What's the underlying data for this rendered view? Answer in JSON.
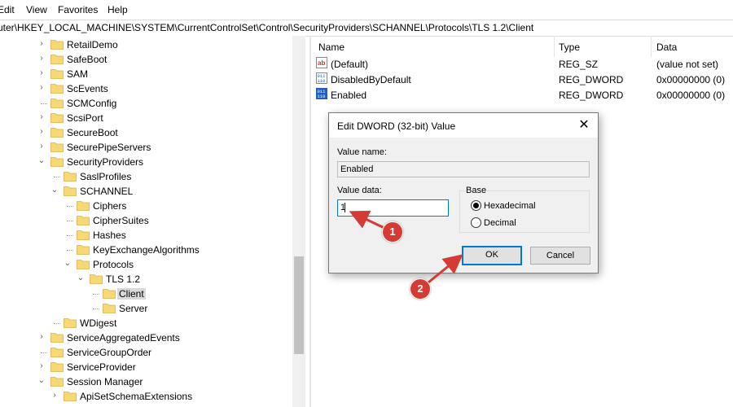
{
  "menu": [
    "Edit",
    "View",
    "Favorites",
    "Help"
  ],
  "address": "uter\\HKEY_LOCAL_MACHINE\\SYSTEM\\CurrentControlSet\\Control\\SecurityProviders\\SCHANNEL\\Protocols\\TLS 1.2\\Client",
  "tree": [
    {
      "label": "RetailDemo",
      "level": 0,
      "expander": "collapsed"
    },
    {
      "label": "SafeBoot",
      "level": 0,
      "expander": "collapsed"
    },
    {
      "label": "SAM",
      "level": 0,
      "expander": "collapsed"
    },
    {
      "label": "ScEvents",
      "level": 0,
      "expander": "collapsed"
    },
    {
      "label": "SCMConfig",
      "level": 0,
      "expander": "none"
    },
    {
      "label": "ScsiPort",
      "level": 0,
      "expander": "collapsed"
    },
    {
      "label": "SecureBoot",
      "level": 0,
      "expander": "collapsed"
    },
    {
      "label": "SecurePipeServers",
      "level": 0,
      "expander": "collapsed"
    },
    {
      "label": "SecurityProviders",
      "level": 0,
      "expander": "expanded"
    },
    {
      "label": "SaslProfiles",
      "level": 1,
      "expander": "none"
    },
    {
      "label": "SCHANNEL",
      "level": 1,
      "expander": "expanded"
    },
    {
      "label": "Ciphers",
      "level": 2,
      "expander": "none"
    },
    {
      "label": "CipherSuites",
      "level": 2,
      "expander": "none"
    },
    {
      "label": "Hashes",
      "level": 2,
      "expander": "none"
    },
    {
      "label": "KeyExchangeAlgorithms",
      "level": 2,
      "expander": "none"
    },
    {
      "label": "Protocols",
      "level": 2,
      "expander": "expanded"
    },
    {
      "label": "TLS 1.2",
      "level": 3,
      "expander": "expanded"
    },
    {
      "label": "Client",
      "level": 4,
      "expander": "none",
      "selected": true
    },
    {
      "label": "Server",
      "level": 4,
      "expander": "none"
    },
    {
      "label": "WDigest",
      "level": 1,
      "expander": "none"
    },
    {
      "label": "ServiceAggregatedEvents",
      "level": 0,
      "expander": "collapsed"
    },
    {
      "label": "ServiceGroupOrder",
      "level": 0,
      "expander": "none"
    },
    {
      "label": "ServiceProvider",
      "level": 0,
      "expander": "collapsed"
    },
    {
      "label": "Session Manager",
      "level": 0,
      "expander": "expanded"
    },
    {
      "label": "ApiSetSchemaExtensions",
      "level": 1,
      "expander": "collapsed"
    }
  ],
  "list": {
    "headers": {
      "name": "Name",
      "type": "Type",
      "data": "Data"
    },
    "rows": [
      {
        "name": "(Default)",
        "type": "REG_SZ",
        "data": "(value not set)",
        "icon": "string-value-icon"
      },
      {
        "name": "DisabledByDefault",
        "type": "REG_DWORD",
        "data": "0x00000000 (0)",
        "icon": "dword-value-icon"
      },
      {
        "name": "Enabled",
        "type": "REG_DWORD",
        "data": "0x00000000 (0)",
        "icon": "dword-value-icon"
      }
    ]
  },
  "dialog": {
    "title": "Edit DWORD (32-bit) Value",
    "value_name_label": "Value name:",
    "value_name": "Enabled",
    "value_data_label": "Value data:",
    "value_data": "1",
    "base_label": "Base",
    "hex_label": "Hexadecimal",
    "dec_label": "Decimal",
    "selected_base": "Hexadecimal",
    "ok_label": "OK",
    "cancel_label": "Cancel",
    "close_glyph": "✕"
  },
  "annotations": [
    "1",
    "2"
  ],
  "colors": {
    "annotation": "#d63a34",
    "folder": "#f8d775",
    "accent": "#0078d7"
  }
}
